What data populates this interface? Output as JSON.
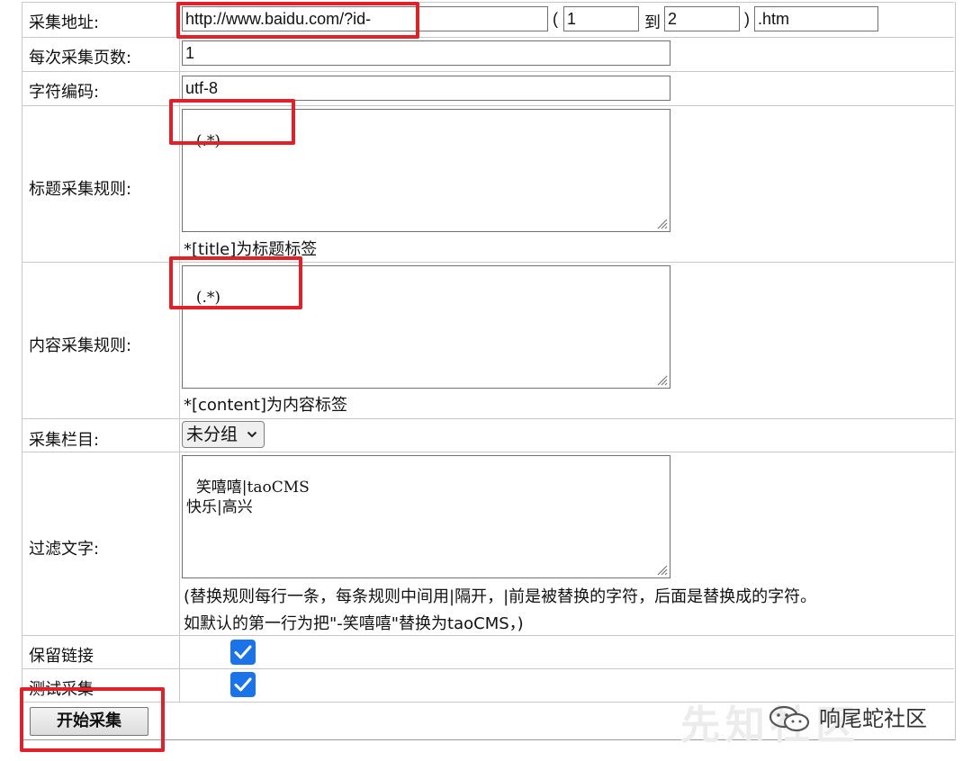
{
  "form": {
    "url_label": "采集地址:",
    "url_value": "http://www.baidu.com/?id-",
    "paren_open": "(",
    "range_start": "1",
    "to_label": "到",
    "range_end": "2",
    "paren_close": ")",
    "suffix_value": ".htm",
    "pages_label": "每次采集页数:",
    "pages_value": "1",
    "charset_label": "字符编码:",
    "charset_value": "utf-8",
    "title_rule_label": "标题采集规则:",
    "title_rule_value": "(.*)",
    "title_rule_hint": "*[title]为标题标签",
    "content_rule_label": "内容采集规则:",
    "content_rule_value": "(.*)",
    "content_rule_hint": "*[content]为内容标签",
    "category_label": "采集栏目:",
    "category_selected": "未分组",
    "filter_label": "过滤文字:",
    "filter_value": "笑嘻嘻|taoCMS\n快乐|高兴",
    "filter_hint_1": "(替换规则每行一条，每条规则中间用|隔开，|前是被替换的字符，后面是替换成的字符。",
    "filter_hint_2": "如默认的第一行为把\"-笑嘻嘻\"替换为taoCMS，)",
    "keep_links_label": "保留链接",
    "keep_links_checked": true,
    "test_label": "测试采集",
    "test_checked": true,
    "start_button": "开始采集"
  },
  "watermark": {
    "text": "响尾蛇社区",
    "background_text": "先知社区"
  },
  "colors": {
    "highlight": "#e2202a",
    "checkbox": "#1a73e8"
  }
}
